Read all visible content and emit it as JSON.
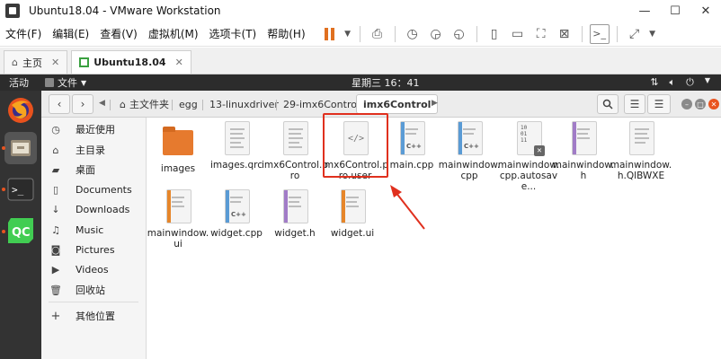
{
  "vm": {
    "title": "Ubuntu18.04 - VMware Workstation",
    "menu": [
      "文件(F)",
      "编辑(E)",
      "查看(V)",
      "虚拟机(M)",
      "选项卡(T)",
      "帮助(H)"
    ],
    "window_buttons": [
      "—",
      "☐",
      "✕"
    ],
    "tabs": [
      {
        "label": "主页",
        "icon": "home-icon"
      },
      {
        "label": "Ubuntu18.04",
        "icon": "vm-icon"
      }
    ]
  },
  "ubuntu": {
    "activities": "活动",
    "app_menu": "文件",
    "clock": "星期三 16：41"
  },
  "nautilus": {
    "breadcrumbs": [
      "主文件夹",
      "egg",
      "13-linuxdriver",
      "29-imx6Control",
      "imx6Control"
    ],
    "sidebar": [
      {
        "icon": "recent-icon",
        "label": "最近使用"
      },
      {
        "icon": "home-icon",
        "label": "主目录"
      },
      {
        "icon": "desktop-icon",
        "label": "桌面"
      },
      {
        "icon": "documents-icon",
        "label": "Documents"
      },
      {
        "icon": "downloads-icon",
        "label": "Downloads"
      },
      {
        "icon": "music-icon",
        "label": "Music"
      },
      {
        "icon": "pictures-icon",
        "label": "Pictures"
      },
      {
        "icon": "videos-icon",
        "label": "Videos"
      },
      {
        "icon": "trash-icon",
        "label": "回收站"
      },
      {
        "icon": "plus-icon",
        "label": "其他位置"
      }
    ],
    "files": [
      {
        "name": "images",
        "type": "folder"
      },
      {
        "name": "images.qrc",
        "type": "doc"
      },
      {
        "name": "imx6Control.pro",
        "type": "doc"
      },
      {
        "name": "imx6Control.pro.user",
        "type": "xml"
      },
      {
        "name": "main.cpp",
        "type": "cpp",
        "tag": "C++"
      },
      {
        "name": "mainwindow.cpp",
        "type": "cpp",
        "tag": "C++"
      },
      {
        "name": "mainwindow.cpp.autosave...",
        "type": "binary"
      },
      {
        "name": "mainwindow.h",
        "type": "h"
      },
      {
        "name": "mainwindow.h.QlBWXE",
        "type": "doc"
      },
      {
        "name": "mainwindow.ui",
        "type": "ui"
      },
      {
        "name": "widget.cpp",
        "type": "cpp",
        "tag": "C++"
      },
      {
        "name": "widget.h",
        "type": "h"
      },
      {
        "name": "widget.ui",
        "type": "ui"
      }
    ]
  }
}
